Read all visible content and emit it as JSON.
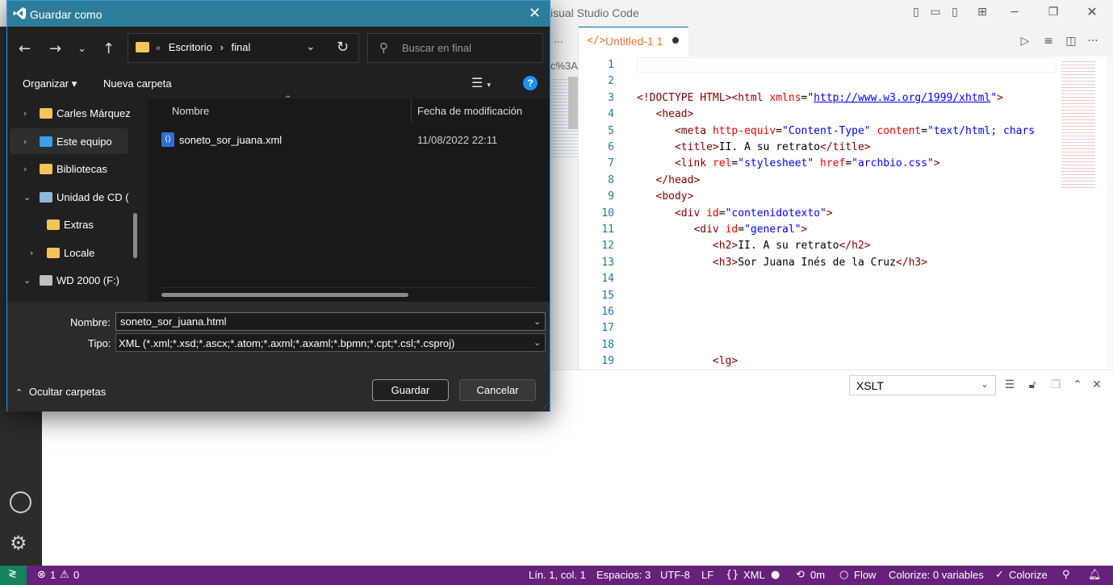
{
  "vscode": {
    "window_title": "isual Studio Code",
    "sidebar_fragment": "c%3A",
    "tab": {
      "icon": "</>",
      "label": "Untitled-1 1"
    },
    "line_numbers": [
      "1",
      "2",
      "3",
      "4",
      "5",
      "6",
      "7",
      "8",
      "9",
      "10",
      "11",
      "12",
      "13",
      "14",
      "15",
      "16",
      "17",
      "18",
      "19"
    ],
    "code_lines": [
      {
        "indent": "",
        "parts": []
      },
      {
        "indent": "",
        "parts": []
      },
      {
        "indent": "",
        "parts": [
          [
            "punc",
            "<!"
          ],
          [
            "tag",
            "DOCTYPE HTML"
          ],
          [
            "punc",
            "><"
          ],
          [
            "tag",
            "html "
          ],
          [
            "attr",
            "xmlns"
          ],
          [
            "",
            "=\""
          ],
          [
            "link",
            "http://www.w3.org/1999/xhtml"
          ],
          [
            "val",
            "\""
          ],
          [
            "punc",
            ">"
          ]
        ]
      },
      {
        "indent": "   ",
        "parts": [
          [
            "punc",
            "<"
          ],
          [
            "tag",
            "head"
          ],
          [
            "punc",
            ">"
          ]
        ]
      },
      {
        "indent": "      ",
        "parts": [
          [
            "punc",
            "<"
          ],
          [
            "tag",
            "meta "
          ],
          [
            "attr",
            "http-equiv"
          ],
          [
            "",
            "="
          ],
          [
            "val",
            "\"Content-Type\""
          ],
          [
            "attr",
            " content"
          ],
          [
            "",
            "="
          ],
          [
            "val",
            "\"text/html; chars"
          ]
        ]
      },
      {
        "indent": "      ",
        "parts": [
          [
            "punc",
            "<"
          ],
          [
            "tag",
            "title"
          ],
          [
            "punc",
            ">"
          ],
          [
            "",
            "II. A su retrato"
          ],
          [
            "punc",
            "</"
          ],
          [
            "tag",
            "title"
          ],
          [
            "punc",
            ">"
          ]
        ]
      },
      {
        "indent": "      ",
        "parts": [
          [
            "punc",
            "<"
          ],
          [
            "tag",
            "link "
          ],
          [
            "attr",
            "rel"
          ],
          [
            "",
            "="
          ],
          [
            "val",
            "\"stylesheet\""
          ],
          [
            "attr",
            " href"
          ],
          [
            "",
            "="
          ],
          [
            "val",
            "\"archbio.css\""
          ],
          [
            "punc",
            ">"
          ]
        ]
      },
      {
        "indent": "   ",
        "parts": [
          [
            "punc",
            "</"
          ],
          [
            "tag",
            "head"
          ],
          [
            "punc",
            ">"
          ]
        ]
      },
      {
        "indent": "   ",
        "parts": [
          [
            "punc",
            "<"
          ],
          [
            "tag",
            "body"
          ],
          [
            "punc",
            ">"
          ]
        ]
      },
      {
        "indent": "      ",
        "parts": [
          [
            "punc",
            "<"
          ],
          [
            "tag",
            "div "
          ],
          [
            "attr",
            "id"
          ],
          [
            "",
            "="
          ],
          [
            "val",
            "\"contenidotexto\""
          ],
          [
            "punc",
            ">"
          ]
        ]
      },
      {
        "indent": "         ",
        "parts": [
          [
            "punc",
            "<"
          ],
          [
            "tag",
            "div "
          ],
          [
            "attr",
            "id"
          ],
          [
            "",
            "="
          ],
          [
            "val",
            "\"general\""
          ],
          [
            "punc",
            ">"
          ]
        ]
      },
      {
        "indent": "            ",
        "parts": [
          [
            "punc",
            "<"
          ],
          [
            "tag",
            "h2"
          ],
          [
            "punc",
            ">"
          ],
          [
            "",
            "II. A su retrato"
          ],
          [
            "punc",
            "</"
          ],
          [
            "tag",
            "h2"
          ],
          [
            "punc",
            ">"
          ]
        ]
      },
      {
        "indent": "            ",
        "parts": [
          [
            "punc",
            "<"
          ],
          [
            "tag",
            "h3"
          ],
          [
            "punc",
            ">"
          ],
          [
            "",
            "Sor Juana Inés de la Cruz"
          ],
          [
            "punc",
            "</"
          ],
          [
            "tag",
            "h3"
          ],
          [
            "punc",
            ">"
          ]
        ]
      },
      {
        "indent": "",
        "parts": []
      },
      {
        "indent": "",
        "parts": []
      },
      {
        "indent": "",
        "parts": []
      },
      {
        "indent": "",
        "parts": []
      },
      {
        "indent": "",
        "parts": []
      },
      {
        "indent": "            ",
        "parts": [
          [
            "punc",
            "<"
          ],
          [
            "tag",
            "lg"
          ],
          [
            "punc",
            ">"
          ]
        ]
      }
    ],
    "panel_select": "XSLT",
    "status": {
      "problems_errors": "1",
      "problems_warnings": "0",
      "position": "Lín. 1, col. 1",
      "spaces": "Espacios: 3",
      "encoding": "UTF-8",
      "eol": "LF",
      "language": "XML",
      "timer": "0m",
      "flow": "Flow",
      "colorize_vars": "Colorize: 0 variables",
      "colorize": "Colorize"
    }
  },
  "dialog": {
    "title": "Guardar como",
    "breadcrumb": {
      "prefix": "«",
      "folder": "Escritorio",
      "sep": "›",
      "current": "final"
    },
    "search_placeholder": "Buscar en final",
    "organize": "Organizar ▾",
    "new_folder": "Nueva carpeta",
    "help": "?",
    "nav_items": [
      {
        "label": "Carles Márquez",
        "chevron": "›",
        "icon": "folder-icon"
      },
      {
        "label": "Este equipo",
        "chevron": "›",
        "icon": "computer-icon"
      },
      {
        "label": "Bibliotecas",
        "chevron": "›",
        "icon": "folder-icon"
      },
      {
        "label": "Unidad de CD (",
        "chevron": "⌄",
        "icon": "cd-drive-icon"
      },
      {
        "label": "Extras",
        "chevron": "",
        "icon": "folder-icon"
      },
      {
        "label": "Locale",
        "chevron": "›",
        "icon": "folder-icon"
      },
      {
        "label": "WD 2000 (F:)",
        "chevron": "⌄",
        "icon": "drive-icon"
      }
    ],
    "columns": {
      "name": "Nombre",
      "date": "Fecha de modificación"
    },
    "files": [
      {
        "name": "soneto_sor_juana.xml",
        "date": "11/08/2022 22:11"
      }
    ],
    "filename_label": "Nombre:",
    "filename_value": "soneto_sor_juana.html",
    "type_label": "Tipo:",
    "type_value": "XML (*.xml;*.xsd;*.ascx;*.atom;*.axml;*.axaml;*.bpmn;*.cpt;*.csl;*.csproj)",
    "hide_folders": "Ocultar carpetas",
    "save": "Guardar",
    "cancel": "Cancelar"
  }
}
